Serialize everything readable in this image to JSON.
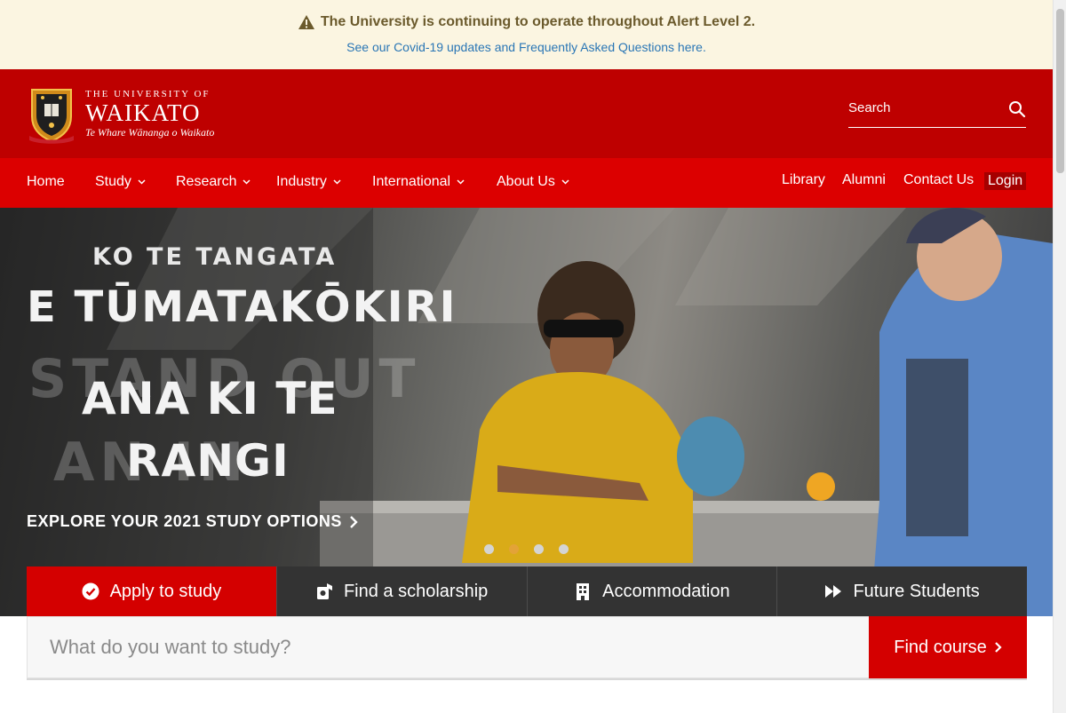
{
  "alert": {
    "title": "The University is continuing to operate throughout Alert Level 2.",
    "link": "See our Covid-19 updates and Frequently Asked Questions here."
  },
  "brand": {
    "small": "THE UNIVERSITY OF",
    "name": "WAIKATO",
    "maori": "Te Whare Wānanga o Waikato"
  },
  "search": {
    "placeholder": "Search",
    "icon": "search-icon"
  },
  "nav": {
    "home": "Home",
    "study": "Study",
    "research": "Research",
    "industry": "Industry",
    "international": "International",
    "about": "About Us",
    "library": "Library",
    "alumni": "Alumni",
    "contact": "Contact Us",
    "login": "Login"
  },
  "hero": {
    "line1": "KO TE TANGATA",
    "line2": "E TŪMATAKŌKIRI",
    "line3": "ANA KI TE",
    "line4": "RANGI",
    "ghost1": "STAND OUT",
    "ghost2": "AN IN",
    "cta": "EXPLORE YOUR 2021 STUDY OPTIONS",
    "slides": 4,
    "active_slide": 2
  },
  "tiles": [
    {
      "label": "Apply to study",
      "icon": "check-circle-icon"
    },
    {
      "label": "Find a scholarship",
      "icon": "scholarship-icon"
    },
    {
      "label": "Accommodation",
      "icon": "building-icon"
    },
    {
      "label": "Future Students",
      "icon": "fast-forward-icon"
    }
  ],
  "course_search": {
    "placeholder": "What do you want to study?",
    "button": "Find course"
  },
  "colors": {
    "header_red": "#be0000",
    "nav_red": "#dc0000",
    "accent_red": "#d40000",
    "tile_dark": "#333333",
    "alert_bg": "#fbf5e1",
    "link_blue": "#2a76b5"
  }
}
